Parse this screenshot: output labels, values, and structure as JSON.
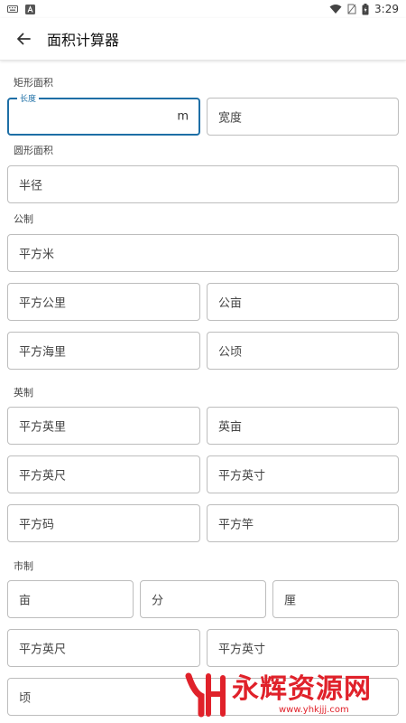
{
  "status": {
    "time": "3:29"
  },
  "appbar": {
    "title": "面积计算器"
  },
  "sections": {
    "rect": "矩形面积",
    "circle": "圆形面积",
    "metric": "公制",
    "imperial": "英制",
    "market": "市制"
  },
  "fields": {
    "length_label": "长度",
    "length_value": "",
    "length_unit": "m",
    "width": "宽度",
    "radius": "半径",
    "sq_meter": "平方米",
    "sq_km": "平方公里",
    "mu_metric": "公亩",
    "sq_nautical_mile": "平方海里",
    "hectare": "公顷",
    "sq_mile": "平方英里",
    "acre": "英亩",
    "sq_foot": "平方英尺",
    "sq_inch": "平方英寸",
    "sq_yard": "平方码",
    "sq_rod": "平方竿",
    "mu": "亩",
    "fen": "分",
    "li": "厘",
    "sq_chi": "平方英尺",
    "sq_cun": "平方英寸",
    "qing": "顷"
  },
  "watermark": {
    "main": "永辉资源网",
    "sub": "www.yhkjjj.com"
  },
  "colors": {
    "accent": "#1e6fa6",
    "border": "#bdbdbd",
    "watermark": "#e0212a"
  }
}
